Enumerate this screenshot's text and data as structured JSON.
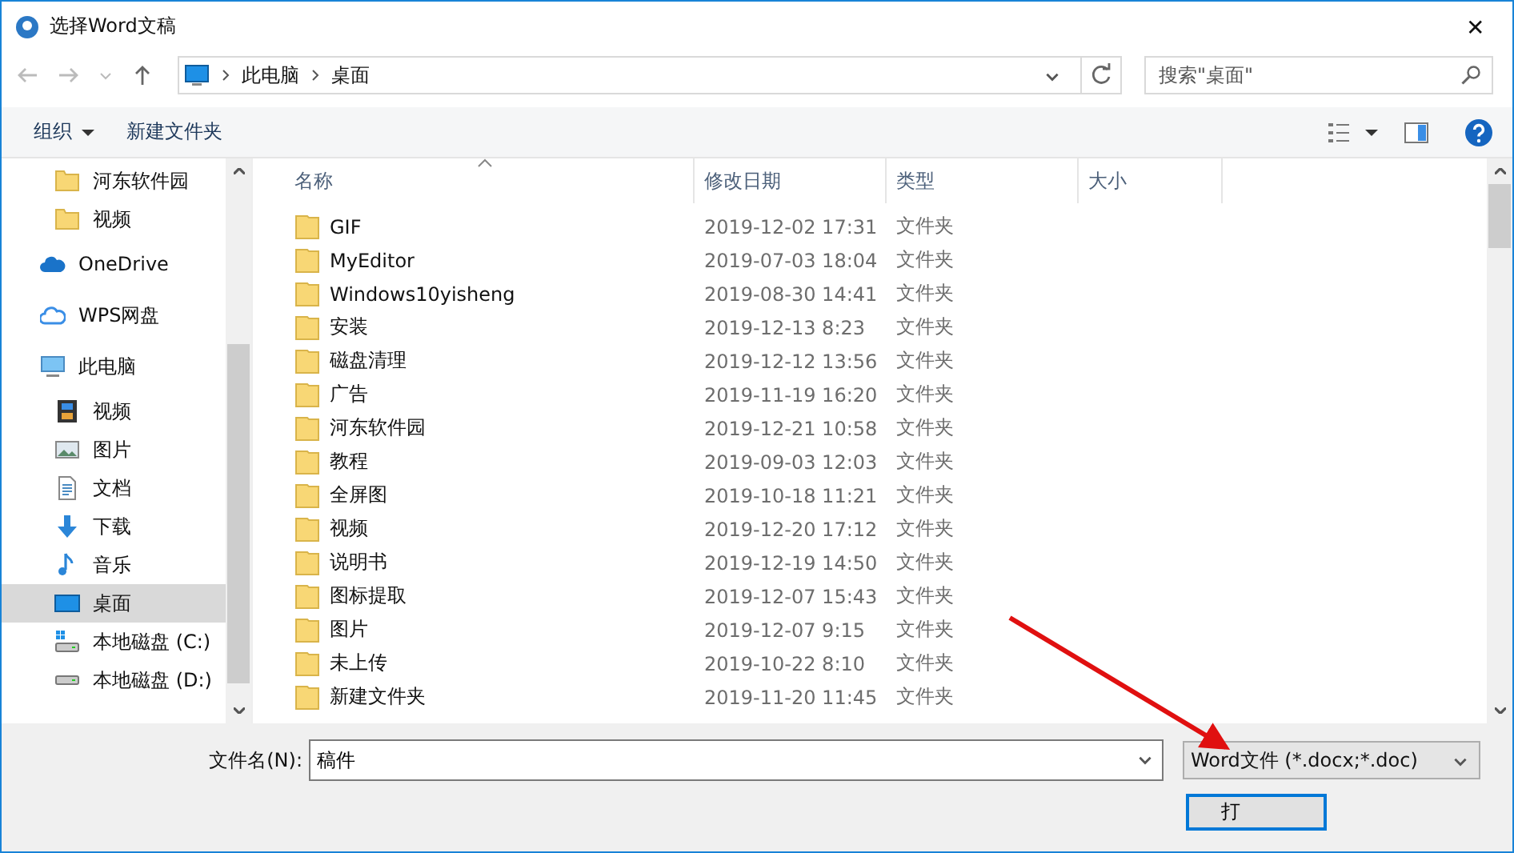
{
  "window": {
    "title": "选择Word文稿",
    "close": "✕"
  },
  "address": {
    "crumbs": [
      "此电脑",
      "桌面"
    ],
    "search_placeholder": "搜索\"桌面\""
  },
  "toolbar": {
    "organize": "组织",
    "new_folder": "新建文件夹"
  },
  "sidebar": {
    "quick_access": [
      {
        "label": "河东软件园",
        "kind": "folder",
        "selected": false
      },
      {
        "label": "视频",
        "kind": "folder",
        "selected": false
      }
    ],
    "items": [
      {
        "label": "OneDrive",
        "kind": "cloud",
        "selected": false
      },
      {
        "label": "WPS网盘",
        "kind": "netdisk",
        "selected": false
      },
      {
        "label": "此电脑",
        "kind": "computer",
        "selected": false,
        "children": [
          {
            "label": "视频",
            "kind": "video",
            "selected": false
          },
          {
            "label": "图片",
            "kind": "image",
            "selected": false
          },
          {
            "label": "文档",
            "kind": "document",
            "selected": false
          },
          {
            "label": "下载",
            "kind": "download",
            "selected": false
          },
          {
            "label": "音乐",
            "kind": "music",
            "selected": false
          },
          {
            "label": "桌面",
            "kind": "desktop",
            "selected": true
          },
          {
            "label": "本地磁盘 (C:)",
            "kind": "systemdrive",
            "selected": false
          },
          {
            "label": "本地磁盘 (D:)",
            "kind": "drive",
            "selected": false
          }
        ]
      }
    ]
  },
  "table": {
    "columns": [
      "名称",
      "修改日期",
      "类型",
      "大小"
    ],
    "rows": [
      {
        "name": "GIF",
        "date": "2019-12-02 17:31",
        "type": "文件夹"
      },
      {
        "name": "MyEditor",
        "date": "2019-07-03 18:04",
        "type": "文件夹"
      },
      {
        "name": "Windows10yisheng",
        "date": "2019-08-30 14:41",
        "type": "文件夹"
      },
      {
        "name": "安装",
        "date": "2019-12-13 8:23",
        "type": "文件夹"
      },
      {
        "name": "磁盘清理",
        "date": "2019-12-12 13:56",
        "type": "文件夹"
      },
      {
        "name": "广告",
        "date": "2019-11-19 16:20",
        "type": "文件夹"
      },
      {
        "name": "河东软件园",
        "date": "2019-12-21 10:58",
        "type": "文件夹"
      },
      {
        "name": "教程",
        "date": "2019-09-03 12:03",
        "type": "文件夹"
      },
      {
        "name": "全屏图",
        "date": "2019-10-18 11:21",
        "type": "文件夹"
      },
      {
        "name": "视频",
        "date": "2019-12-20 17:12",
        "type": "文件夹"
      },
      {
        "name": "说明书",
        "date": "2019-12-19 14:50",
        "type": "文件夹"
      },
      {
        "name": "图标提取",
        "date": "2019-12-07 15:43",
        "type": "文件夹"
      },
      {
        "name": "图片",
        "date": "2019-12-07 9:15",
        "type": "文件夹"
      },
      {
        "name": "未上传",
        "date": "2019-10-22 8:10",
        "type": "文件夹"
      },
      {
        "name": "新建文件夹",
        "date": "2019-11-20 11:45",
        "type": "文件夹"
      }
    ]
  },
  "footer": {
    "filename_label": "文件名(N):",
    "filename": "稿件",
    "filter": "Word文件 (*.docx;*.doc)",
    "open_button": "打"
  }
}
